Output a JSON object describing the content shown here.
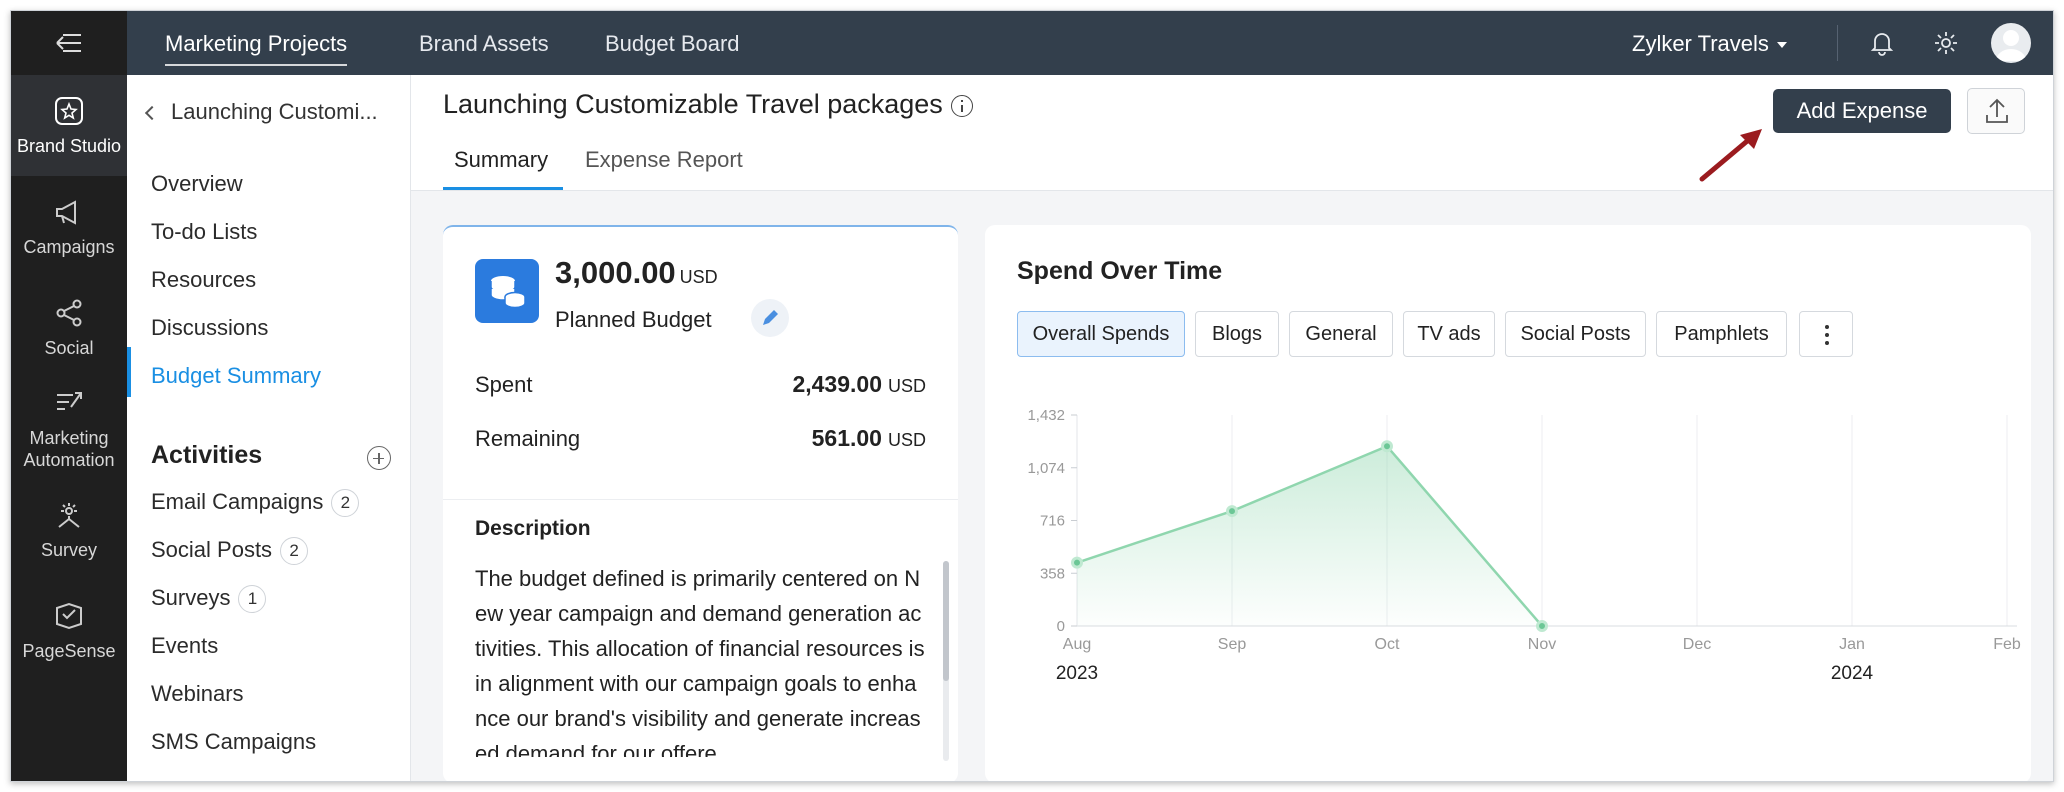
{
  "topbar": {
    "tabs": [
      "Marketing Projects",
      "Brand Assets",
      "Budget Board"
    ],
    "org_name": "Zylker Travels"
  },
  "rail": {
    "items": [
      "Brand Studio",
      "Campaigns",
      "Social",
      "Marketing Automation",
      "Survey",
      "PageSense"
    ]
  },
  "sidebar": {
    "project": "Launching Customi...",
    "nav": [
      "Overview",
      "To-do Lists",
      "Resources",
      "Discussions",
      "Budget Summary"
    ],
    "activities_title": "Activities",
    "activities": [
      {
        "label": "Email Campaigns",
        "count": "2"
      },
      {
        "label": "Social Posts",
        "count": "2"
      },
      {
        "label": "Surveys",
        "count": "1"
      },
      {
        "label": "Events",
        "count": ""
      },
      {
        "label": "Webinars",
        "count": ""
      },
      {
        "label": "SMS Campaigns",
        "count": ""
      }
    ]
  },
  "main": {
    "title": "Launching Customizable Travel packages",
    "tabs": [
      "Summary",
      "Expense Report"
    ],
    "add_expense": "Add Expense"
  },
  "budget": {
    "amount": "3,000.00",
    "currency": "USD",
    "planned_label": "Planned Budget",
    "spent_label": "Spent",
    "spent_value": "2,439.00",
    "remaining_label": "Remaining",
    "remaining_value": "561.00",
    "description_title": "Description",
    "description": "The budget defined is primarily centered on New year campaign and demand generation activities. This allocation of financial resources is in alignment with our campaign goals to enhance our brand's visibility and generate increased demand for our offere"
  },
  "chart_section": {
    "title": "Spend Over Time",
    "filters": [
      "Overall Spends",
      "Blogs",
      "General",
      "TV ads",
      "Social Posts",
      "Pamphlets"
    ]
  },
  "chart_data": {
    "type": "area",
    "x": [
      "Aug",
      "Sep",
      "Oct",
      "Nov",
      "Dec",
      "Jan",
      "Feb"
    ],
    "year_labels": [
      "2023",
      "2024"
    ],
    "yticks": [
      "0",
      "358",
      "716",
      "1,074",
      "1,432"
    ],
    "ylim": [
      0,
      1432
    ],
    "series": [
      {
        "values": [
          430,
          780,
          1220,
          0,
          null,
          null,
          null
        ]
      }
    ],
    "color": "#8fd6ae",
    "grid": "vertical"
  }
}
